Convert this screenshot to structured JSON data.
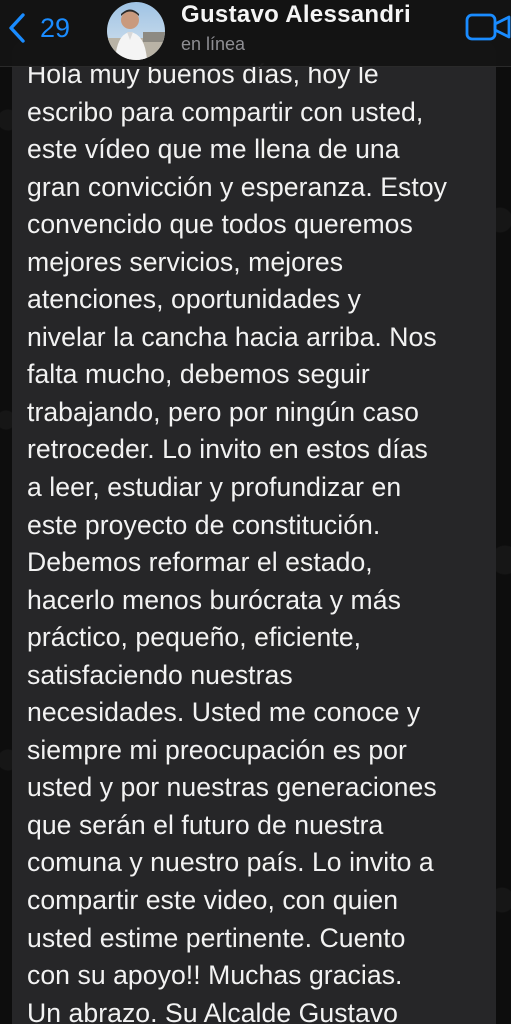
{
  "header": {
    "back_count": "29",
    "contact_name": "Gustavo Alessandri",
    "status": "en línea"
  },
  "message": {
    "text": "Hola muy buenos días, hoy le\nescribo para compartir con usted,\neste vídeo que me llena de una\ngran convicción y esperanza. Estoy\nconvencido que todos queremos\nmejores servicios, mejores\natenciones, oportunidades y\nnivelar la cancha hacia arriba. Nos\nfalta mucho, debemos seguir\ntrabajando, pero por ningún caso\nretroceder.  Lo invito en estos días\na leer, estudiar y profundizar en\neste proyecto de constitución.\nDebemos reformar el estado,\nhacerlo menos burócrata y más\npráctico, pequeño, eficiente,\nsatisfaciendo nuestras\nnecesidades.   Usted me conoce y\nsiempre mi preocupación es por\nusted y por nuestras generaciones\nque serán el futuro de nuestra\ncomuna y nuestro país.  Lo invito a\ncompartir este video, con quien\nusted estime pertinente.  Cuento\ncon su apoyo!!  Muchas gracias.\nUn abrazo.  Su Alcalde Gustavo"
  },
  "colors": {
    "accent": "#1a8cff",
    "bubble": "#262628",
    "background": "#0d0d0d"
  },
  "icons": {
    "back": "chevron-left-icon",
    "video": "video-camera-icon"
  }
}
